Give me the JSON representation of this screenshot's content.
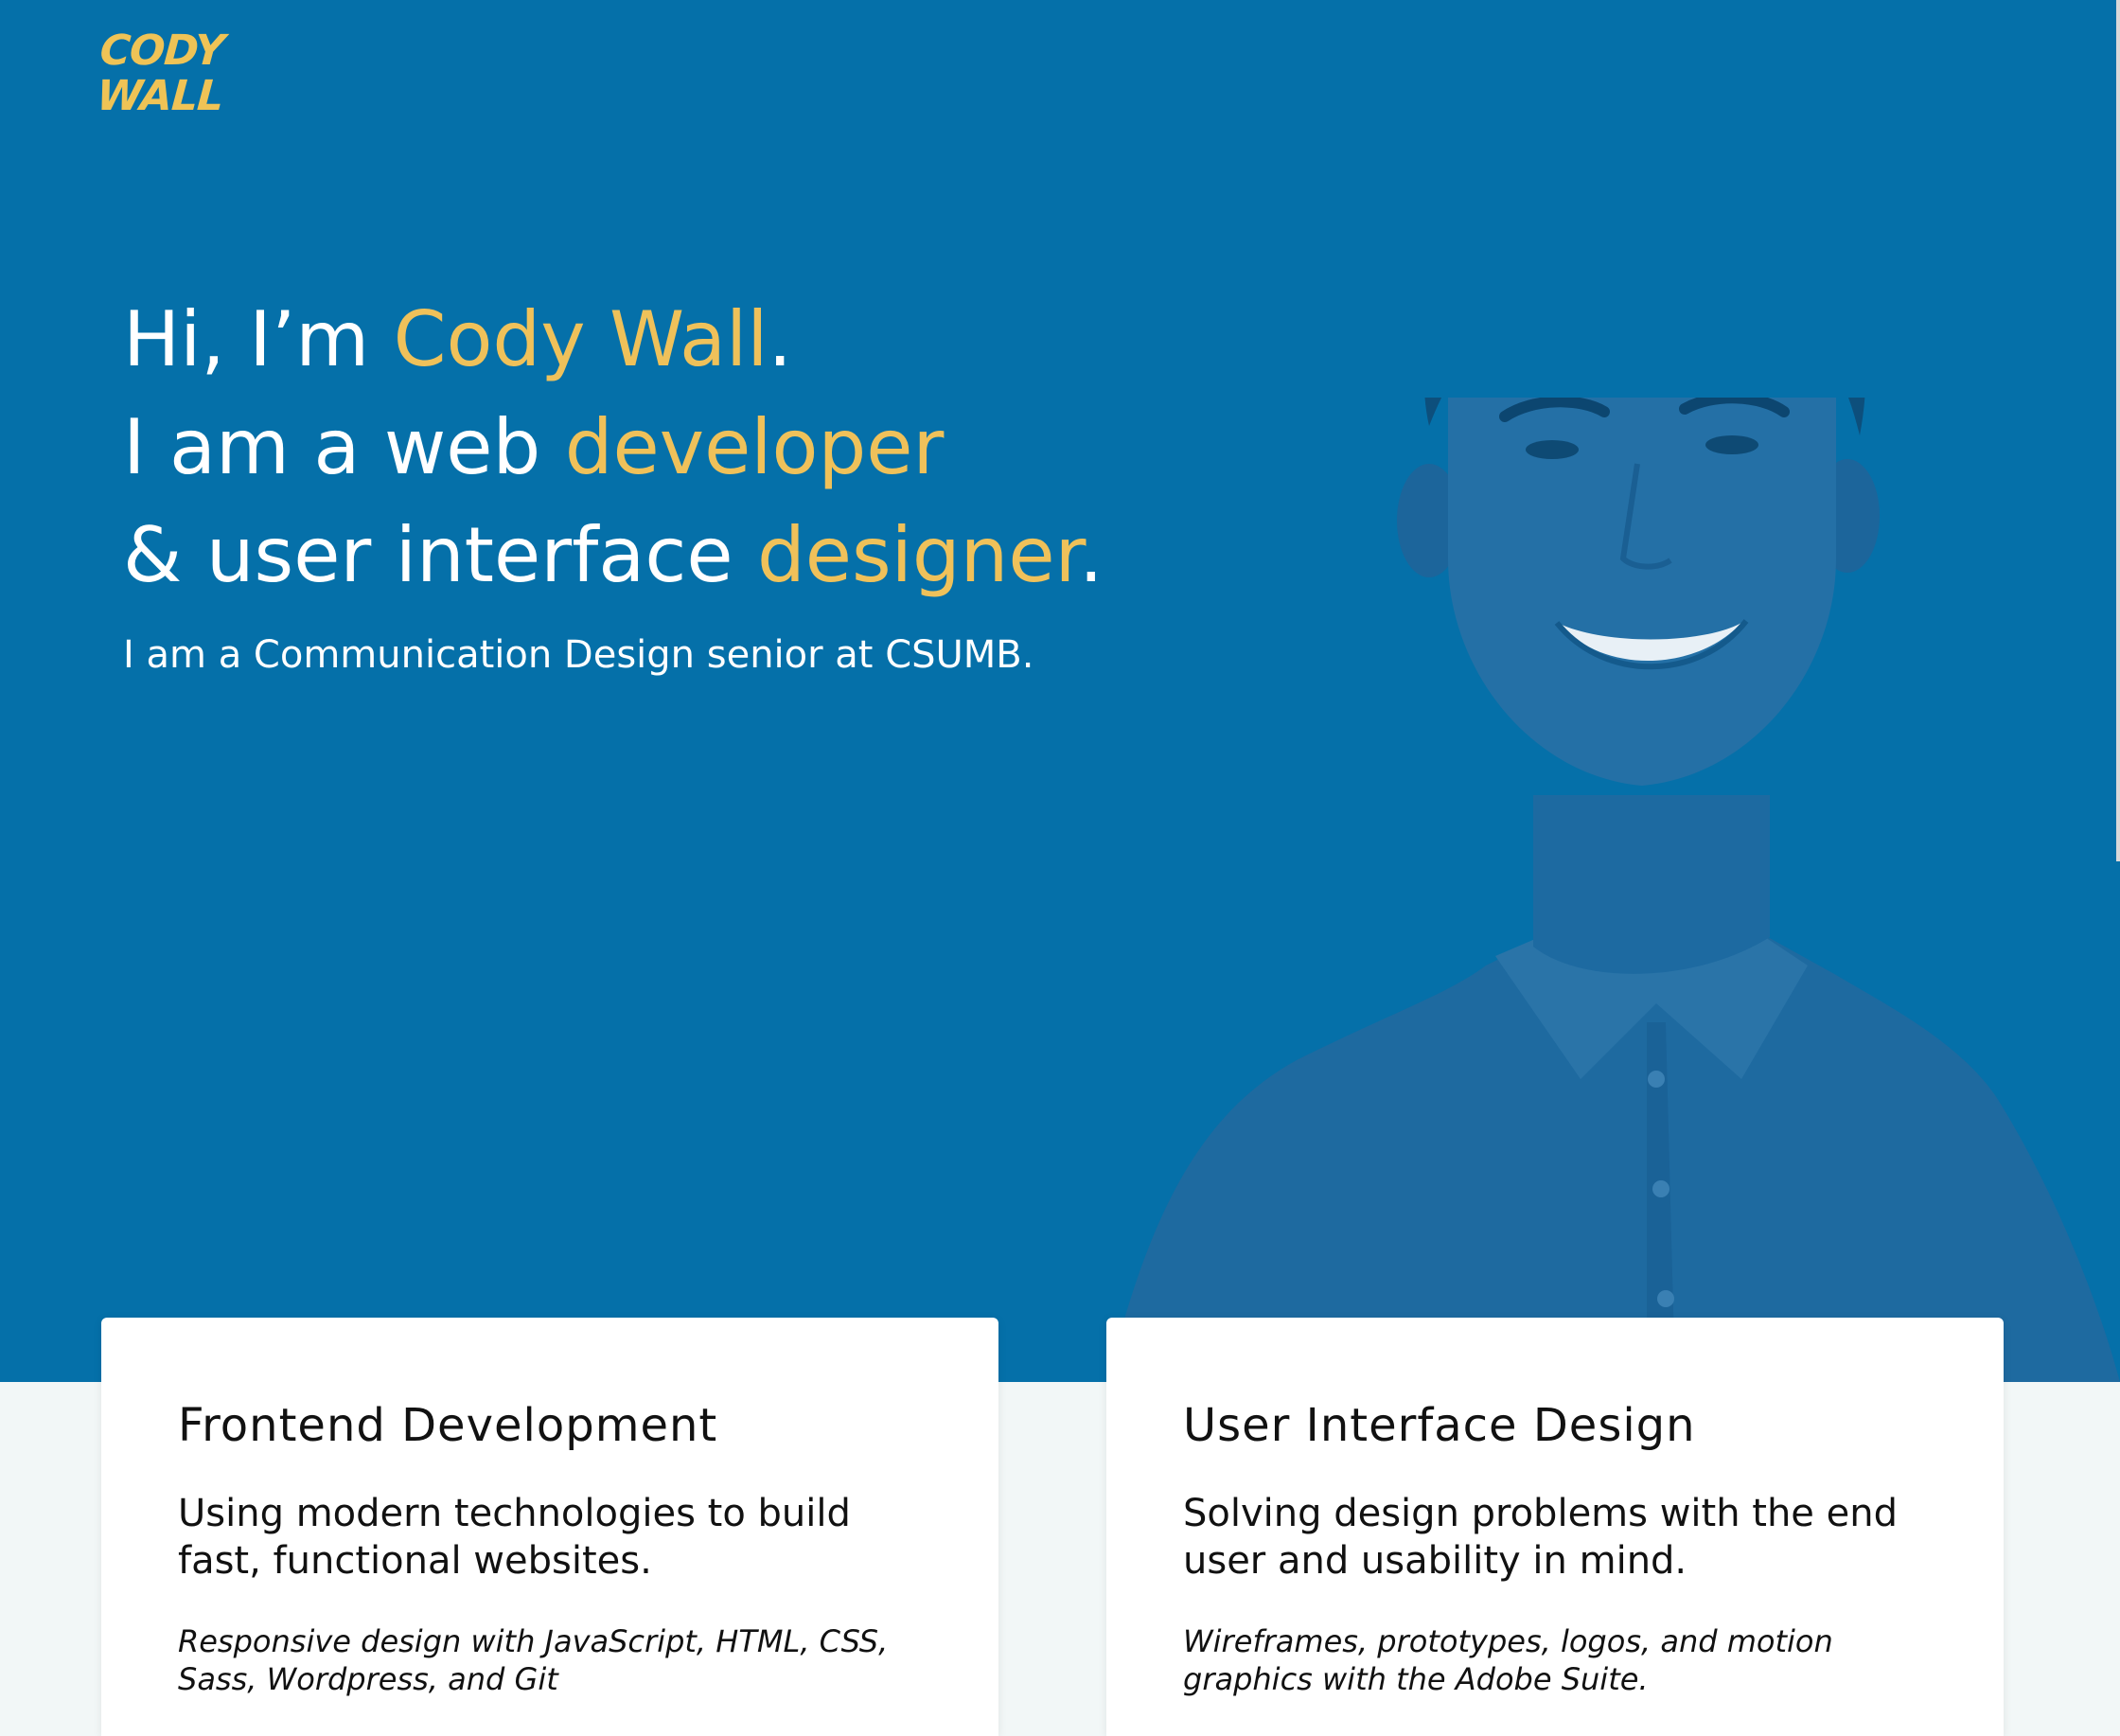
{
  "brand": {
    "logo_line1": "CODY",
    "logo_line2": "WALL",
    "logo_color": "#efc356",
    "hero_background": "#0570a9",
    "accent": "#efc15a"
  },
  "hero": {
    "line1_prefix": "Hi, I’m ",
    "line1_highlight": "Cody Wall",
    "line1_suffix": ".",
    "line2_prefix": "I am a web ",
    "line2_highlight": "developer",
    "line3_prefix": "& user interface ",
    "line3_highlight": "designer",
    "line3_suffix": ".",
    "subtitle": "I am a Communication Design senior at CSUMB."
  },
  "services": [
    {
      "title": "Frontend Development",
      "description": "Using modern technologies to build fast, functional websites.",
      "tech": "Responsive design with JavaScript, HTML, CSS, Sass, Wordpress, and Git"
    },
    {
      "title": "User Interface Design",
      "description": "Solving design problems with the end user and usability in mind.",
      "tech": "Wireframes, prototypes, logos, and motion graphics with the Adobe Suite."
    }
  ]
}
